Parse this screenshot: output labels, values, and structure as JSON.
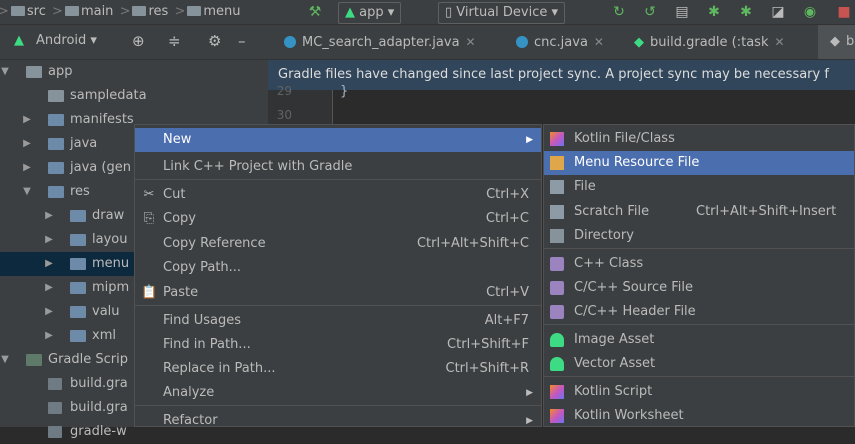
{
  "toolbar": {
    "breadcrumbs": [
      "src",
      "main",
      "res",
      "menu"
    ],
    "run_config": "app",
    "device": "Virtual Device"
  },
  "project_panel": {
    "view_selector": "Android"
  },
  "editor_tabs": [
    {
      "label": "MC_search_adapter.java"
    },
    {
      "label": "cnc.java"
    },
    {
      "label": "build.gradle (:task"
    },
    {
      "label": "b"
    }
  ],
  "banner": {
    "text": "Gradle files have changed since last project sync. A project sync may be necessary f"
  },
  "line_numbers": [
    "29",
    "30"
  ],
  "tree": [
    {
      "label": "app",
      "arrow": "▼"
    },
    {
      "label": "sampledata",
      "arrow": ""
    },
    {
      "label": "manifests",
      "arrow": "▶"
    },
    {
      "label": "java",
      "arrow": "▶"
    },
    {
      "label": "java (gen",
      "arrow": "▶"
    },
    {
      "label": "res",
      "arrow": "▼"
    },
    {
      "label": "draw",
      "arrow": "▶"
    },
    {
      "label": "layou",
      "arrow": "▶"
    },
    {
      "label": "menu",
      "arrow": "▶"
    },
    {
      "label": "mipm",
      "arrow": "▶"
    },
    {
      "label": "valu",
      "arrow": "▶"
    },
    {
      "label": "xml",
      "arrow": "▶"
    },
    {
      "label": "Gradle Scrip",
      "arrow": "▼"
    },
    {
      "label": "build.gra",
      "arrow": ""
    },
    {
      "label": "build.gra",
      "arrow": ""
    },
    {
      "label": "gradle-w",
      "arrow": ""
    }
  ],
  "context_menu": {
    "items": [
      {
        "label": "New",
        "shortcut": "",
        "submenu": true
      },
      {
        "label": "Link C++ Project with Gradle",
        "shortcut": ""
      },
      {
        "label": "Cut",
        "shortcut": "Ctrl+X"
      },
      {
        "label": "Copy",
        "shortcut": "Ctrl+C"
      },
      {
        "label": "Copy Reference",
        "shortcut": "Ctrl+Alt+Shift+C"
      },
      {
        "label": "Copy Path...",
        "shortcut": ""
      },
      {
        "label": "Paste",
        "shortcut": "Ctrl+V"
      },
      {
        "label": "Find Usages",
        "shortcut": "Alt+F7"
      },
      {
        "label": "Find in Path...",
        "shortcut": "Ctrl+Shift+F"
      },
      {
        "label": "Replace in Path...",
        "shortcut": "Ctrl+Shift+R"
      },
      {
        "label": "Analyze",
        "shortcut": "",
        "submenu": true
      },
      {
        "label": "Refactor",
        "shortcut": "",
        "submenu": true
      }
    ]
  },
  "new_submenu": {
    "items": [
      {
        "label": "Kotlin File/Class",
        "shortcut": ""
      },
      {
        "label": "Menu Resource File",
        "shortcut": ""
      },
      {
        "label": "File",
        "shortcut": ""
      },
      {
        "label": "Scratch File",
        "shortcut": "Ctrl+Alt+Shift+Insert"
      },
      {
        "label": "Directory",
        "shortcut": ""
      },
      {
        "label": "C++ Class",
        "shortcut": ""
      },
      {
        "label": "C/C++ Source File",
        "shortcut": ""
      },
      {
        "label": "C/C++ Header File",
        "shortcut": ""
      },
      {
        "label": "Image Asset",
        "shortcut": ""
      },
      {
        "label": "Vector Asset",
        "shortcut": ""
      },
      {
        "label": "Kotlin Script",
        "shortcut": ""
      },
      {
        "label": "Kotlin Worksheet",
        "shortcut": ""
      }
    ]
  },
  "colors": {
    "highlight": "#4b6eaf",
    "panel": "#3c3f41",
    "editor": "#2b2b2b",
    "banner": "#31465a"
  }
}
